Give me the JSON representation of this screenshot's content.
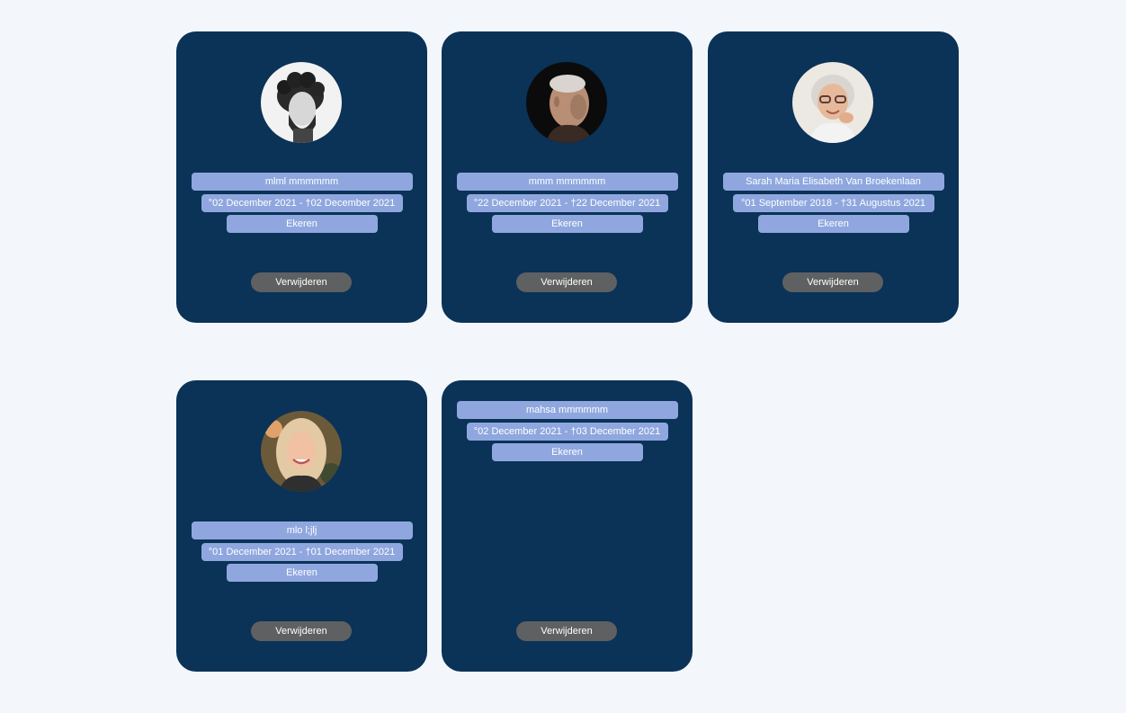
{
  "cards": [
    {
      "has_photo": true,
      "photo_icon": "portrait-bearded-man-curly-hair",
      "name": "mlml mmmmmm",
      "dates": "°02 December 2021 - †02 December 2021",
      "place": "Ekeren",
      "delete_label": "Verwijderen"
    },
    {
      "has_photo": true,
      "photo_icon": "portrait-elderly-man",
      "name": "mmm mmmmmm",
      "dates": "°22 December 2021 - †22 December 2021",
      "place": "Ekeren",
      "delete_label": "Verwijderen"
    },
    {
      "has_photo": true,
      "photo_icon": "portrait-elderly-woman-glasses",
      "name": "Sarah Maria Elisabeth Van Broekenlaan",
      "dates": "°01 September 2018 - †31 Augustus 2021",
      "place": "Ekeren",
      "delete_label": "Verwijderen"
    },
    {
      "has_photo": true,
      "photo_icon": "portrait-blonde-woman",
      "name": "mlo l;jlj",
      "dates": "°01 December 2021 - †01 December 2021",
      "place": "Ekeren",
      "delete_label": "Verwijderen"
    },
    {
      "has_photo": false,
      "name": "mahsa mmmmmm",
      "dates": "°02 December 2021 - †03 December 2021",
      "place": "Ekeren",
      "delete_label": "Verwijderen"
    }
  ],
  "colors": {
    "page_background": "#f3f7fb",
    "card_background": "#0b3257",
    "pill_background": "#8fa7de",
    "button_background": "#5f6061",
    "text": "#ffffff"
  }
}
